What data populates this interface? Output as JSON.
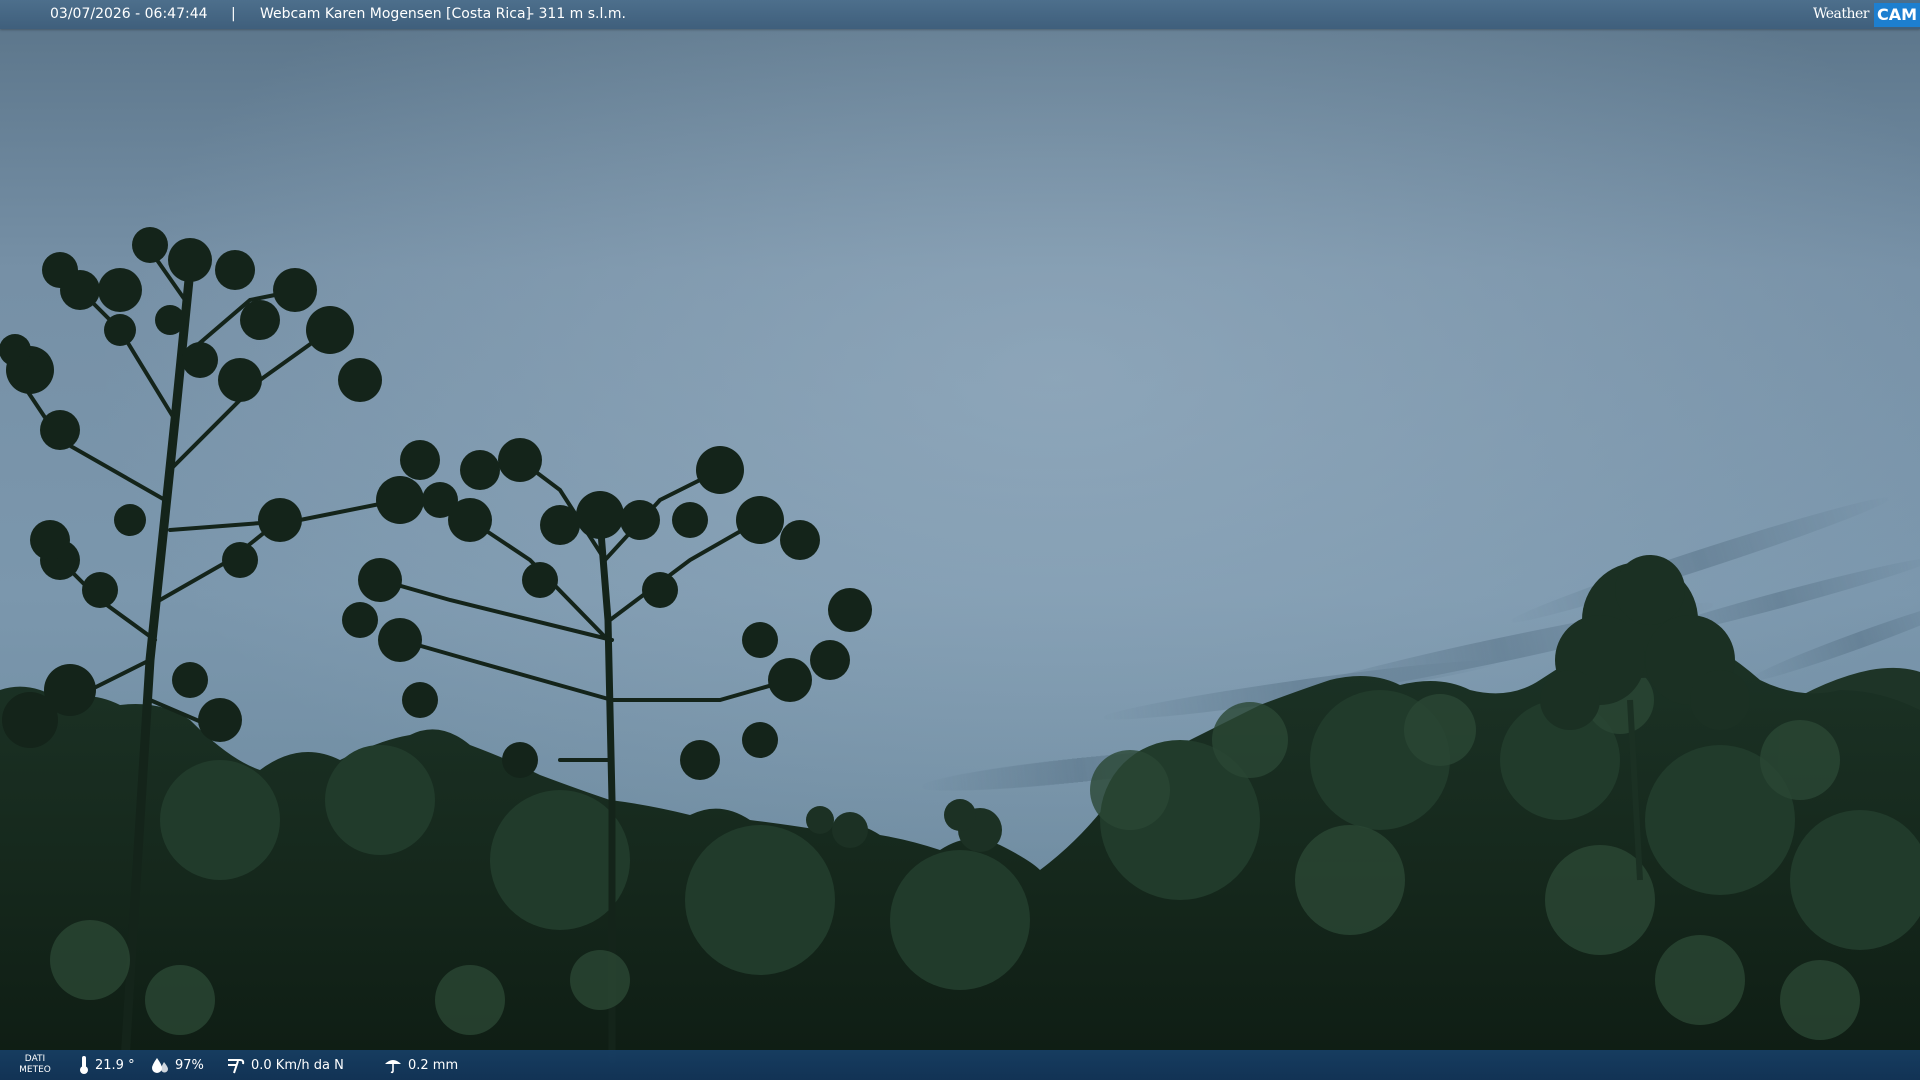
{
  "header": {
    "timestamp": "03/07/2026 - 06:47:44",
    "separator": "|",
    "title": "Webcam Karen Mogensen [Costa Rica]",
    "altitude": "- 311 m s.l.m.",
    "logo": {
      "weather": "Weather",
      "cam": "CAM"
    }
  },
  "weather": {
    "label": "DATI METEO",
    "temperature": "21.9 °",
    "humidity": "97%",
    "wind": "0.0 Km/h da N",
    "rain": "0.2 mm"
  },
  "icons": {
    "temperature": "thermometer-icon",
    "humidity": "humidity-drop-icon",
    "wind": "wind-icon",
    "rain": "rain-icon"
  },
  "colors": {
    "header_bar": "#4a6b88",
    "footer_bar": "#173f66",
    "logo_accent": "#1d7fd0",
    "sky_top": "#5a7489",
    "sky_mid": "#7c97ad",
    "foliage": "#15281c"
  }
}
